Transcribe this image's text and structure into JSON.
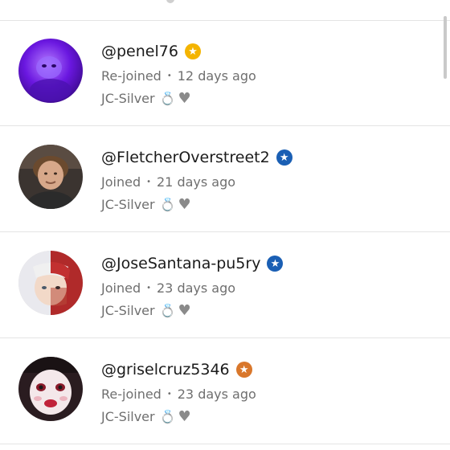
{
  "members": [
    {
      "handle": "@penel76",
      "status": "Re-joined",
      "time": "12 days ago",
      "tier": "JC-Silver",
      "badge_color": "#f4b400",
      "avatar": "purple"
    },
    {
      "handle": "@FletcherOverstreet2",
      "status": "Joined",
      "time": "21 days ago",
      "tier": "JC-Silver",
      "badge_color": "#1a5fb4",
      "avatar": "boy"
    },
    {
      "handle": "@JoseSantana-pu5ry",
      "status": "Joined",
      "time": "23 days ago",
      "tier": "JC-Silver",
      "badge_color": "#1a5fb4",
      "avatar": "anime"
    },
    {
      "handle": "@griselcruz5346",
      "status": "Re-joined",
      "time": "23 days ago",
      "tier": "JC-Silver",
      "badge_color": "#d9772b",
      "avatar": "doll"
    }
  ],
  "icons": {
    "badge": "star-badge-icon",
    "ring": "ring-icon",
    "heart": "grey-heart-icon"
  },
  "glyphs": {
    "star": "★",
    "ring": "💍",
    "heart": "♥",
    "separator": "•"
  }
}
